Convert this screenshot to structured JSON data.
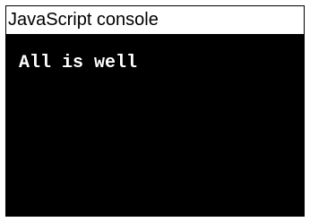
{
  "window": {
    "title": "JavaScript console"
  },
  "console": {
    "lines": [
      "All is well"
    ]
  },
  "colors": {
    "title_bg": "#ffffff",
    "console_bg": "#000000",
    "console_text": "#ffffff"
  }
}
